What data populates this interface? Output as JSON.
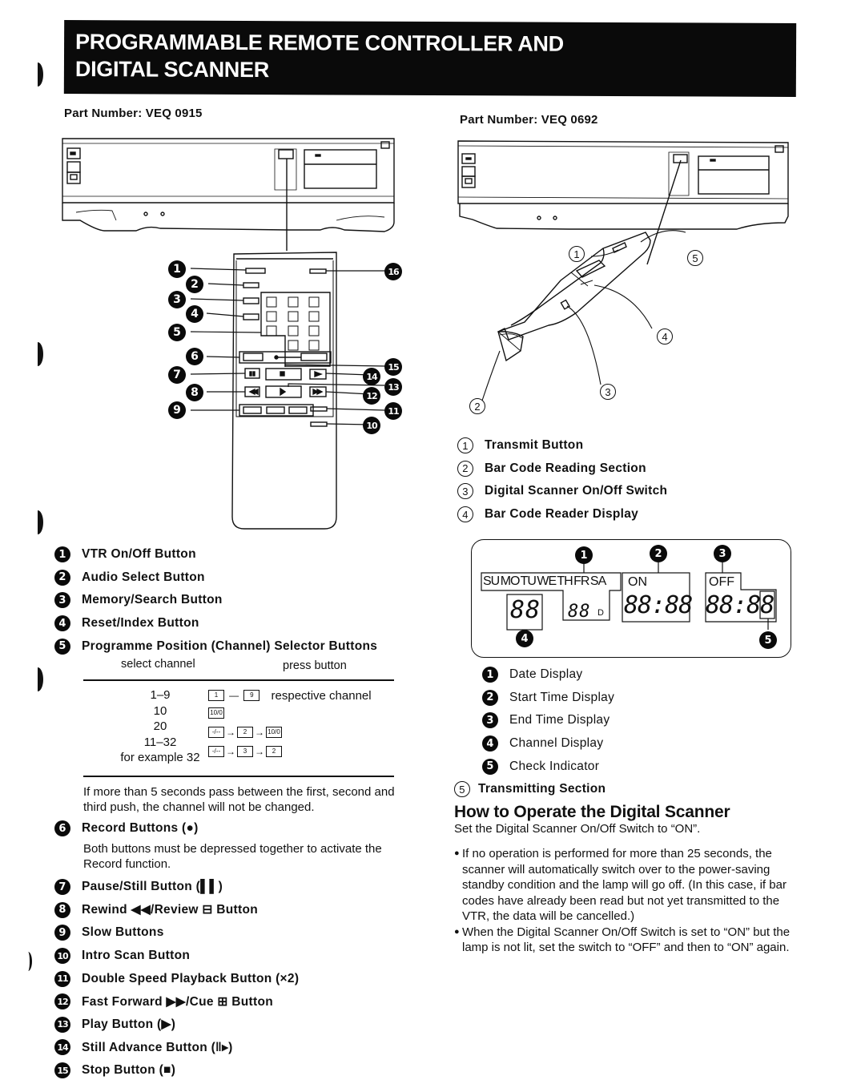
{
  "header": {
    "title_line1": "PROGRAMMABLE REMOTE CONTROLLER AND",
    "title_line2": "DIGITAL SCANNER"
  },
  "left": {
    "part_number": "Part Number: VEQ 0915",
    "callouts": [
      "1",
      "2",
      "3",
      "4",
      "5",
      "6",
      "7",
      "8",
      "9",
      "10",
      "11",
      "12",
      "13",
      "14",
      "15",
      "16"
    ],
    "legend": [
      {
        "num": "1",
        "label": "VTR On/Off Button"
      },
      {
        "num": "2",
        "label": "Audio Select Button"
      },
      {
        "num": "3",
        "label": "Memory/Search Button"
      },
      {
        "num": "4",
        "label": "Reset/Index Button"
      },
      {
        "num": "5",
        "label": "Programme Position (Channel) Selector Buttons"
      }
    ],
    "channel_table": {
      "col_select": "select channel",
      "col_press": "press button",
      "rows": [
        {
          "channel": "1–9",
          "keys": [
            "1",
            "9"
          ],
          "joiner": "—",
          "note": "respective channel"
        },
        {
          "channel": "10",
          "keys": [
            "10/0"
          ],
          "joiner": "",
          "note": ""
        },
        {
          "channel": "20",
          "keys": [
            "-/--",
            "2",
            "10/0"
          ],
          "joiner": "→",
          "note": ""
        },
        {
          "channel": "11–32",
          "keys": [],
          "joiner": "",
          "note": ""
        },
        {
          "channel": "for example 32",
          "keys": [
            "-/--",
            "3",
            "2"
          ],
          "joiner": "→",
          "note": ""
        }
      ]
    },
    "timeout_note": "If more than 5 seconds pass between the first, second and third push, the channel will not be changed.",
    "legend2": [
      {
        "num": "6",
        "label": "Record Buttons (●)",
        "desc": "Both buttons must be depressed together to activate the Record function."
      },
      {
        "num": "7",
        "label": "Pause/Still Button (▌▌)"
      },
      {
        "num": "8",
        "label": "Rewind ◀◀/Review ⊟ Button"
      },
      {
        "num": "9",
        "label": "Slow Buttons"
      },
      {
        "num": "10",
        "label": "Intro Scan Button"
      },
      {
        "num": "11",
        "label": "Double Speed Playback Button (×2)"
      },
      {
        "num": "12",
        "label": "Fast Forward ▶▶/Cue ⊞ Button"
      },
      {
        "num": "13",
        "label": "Play Button (▶)"
      },
      {
        "num": "14",
        "label": "Still Advance Button (‖▸)"
      },
      {
        "num": "15",
        "label": "Stop Button (■)"
      }
    ]
  },
  "right": {
    "part_number": "Part Number: VEQ 0692",
    "scanner_callouts": [
      "1",
      "2",
      "3",
      "4",
      "5"
    ],
    "scanner_legend": [
      {
        "num": "1",
        "label": "Transmit Button"
      },
      {
        "num": "2",
        "label": "Bar Code Reading Section"
      },
      {
        "num": "3",
        "label": "Digital Scanner On/Off Switch"
      },
      {
        "num": "4",
        "label": "Bar Code Reader Display"
      }
    ],
    "lcd": {
      "days": [
        "SU",
        "MO",
        "TU",
        "WE",
        "TH",
        "FR",
        "SA"
      ],
      "channel": "88",
      "date": "88",
      "date_suffix": "D",
      "on_label": "ON",
      "on_time": "88:88",
      "off_label": "OFF",
      "off_time": "88:88",
      "callouts": [
        "1",
        "2",
        "3",
        "4",
        "5"
      ]
    },
    "lcd_legend": [
      {
        "num": "1",
        "label": "Date Display"
      },
      {
        "num": "2",
        "label": "Start Time Display"
      },
      {
        "num": "3",
        "label": "End Time Display"
      },
      {
        "num": "4",
        "label": "Channel Display"
      },
      {
        "num": "5",
        "label": "Check Indicator"
      }
    ],
    "transmitting": {
      "num": "5",
      "label": "Transmitting Section"
    },
    "how_to": {
      "title": "How to Operate the Digital Scanner",
      "intro": "Set the Digital Scanner On/Off Switch to “ON”.",
      "bullets": [
        "If no operation is performed for more than 25 seconds, the scanner will automatically switch over to the power-saving standby condition and the lamp will go off. (In this case, if bar codes have already been read but not yet transmitted to the VTR, the data will be cancelled.)",
        "When the Digital Scanner On/Off Switch is set to “ON” but the lamp is not lit, set the switch to “OFF” and then to “ON” again."
      ]
    }
  }
}
